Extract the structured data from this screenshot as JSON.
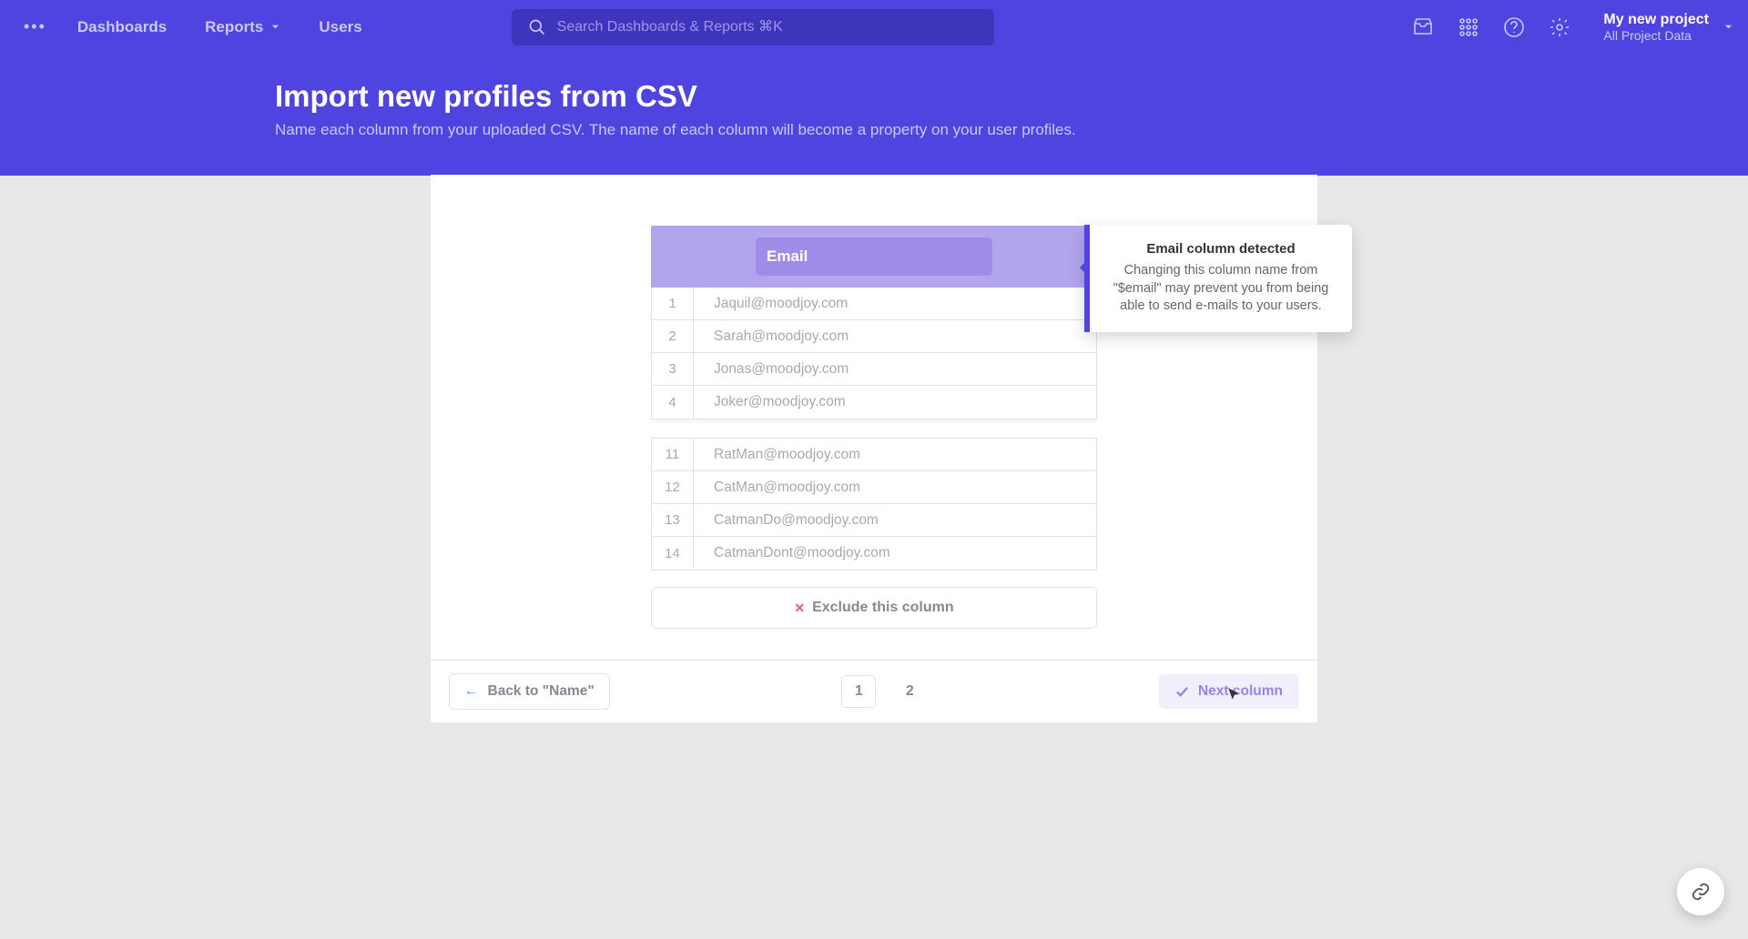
{
  "nav": {
    "dashboards": "Dashboards",
    "reports": "Reports",
    "users": "Users"
  },
  "search": {
    "placeholder": "Search Dashboards & Reports ⌘K"
  },
  "project": {
    "name": "My new project",
    "sub": "All Project Data"
  },
  "header": {
    "title": "Import new profiles from CSV",
    "desc": "Name each column from your uploaded CSV. The name of each column will become a property on your user profiles."
  },
  "column_name": "Email",
  "tooltip": {
    "title": "Email column detected",
    "body": "Changing this column name from \"$email\" may prevent you from being able to send e-mails to your users."
  },
  "rows_top": [
    {
      "n": "1",
      "v": "Jaquil@moodjoy.com"
    },
    {
      "n": "2",
      "v": "Sarah@moodjoy.com"
    },
    {
      "n": "3",
      "v": "Jonas@moodjoy.com"
    },
    {
      "n": "4",
      "v": "Joker@moodjoy.com"
    }
  ],
  "rows_bottom": [
    {
      "n": "11",
      "v": "RatMan@moodjoy.com"
    },
    {
      "n": "12",
      "v": "CatMan@moodjoy.com"
    },
    {
      "n": "13",
      "v": "CatmanDo@moodjoy.com"
    },
    {
      "n": "14",
      "v": "CatmanDont@moodjoy.com"
    }
  ],
  "exclude_label": "Exclude this column",
  "back_label": "Back to \"Name\"",
  "pages": {
    "p1": "1",
    "p2": "2"
  },
  "next_label": "Next column"
}
